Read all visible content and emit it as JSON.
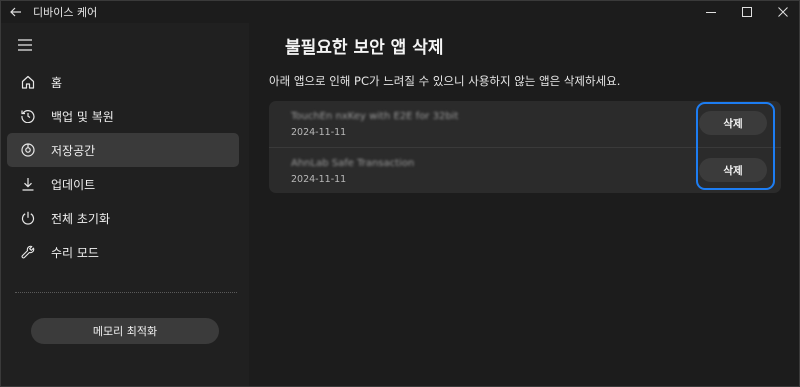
{
  "window": {
    "title": "디바이스 케어",
    "icons": {
      "back": "back-arrow-icon",
      "minimize": "minimize-icon",
      "maximize": "maximize-icon",
      "close": "close-icon"
    }
  },
  "sidebar": {
    "menu_icon": "hamburger-menu-icon",
    "items": [
      {
        "label": "홈",
        "icon": "home-icon",
        "active": false
      },
      {
        "label": "백업 및 복원",
        "icon": "backup-restore-icon",
        "active": false
      },
      {
        "label": "저장공간",
        "icon": "storage-icon",
        "active": true
      },
      {
        "label": "업데이트",
        "icon": "update-download-icon",
        "active": false
      },
      {
        "label": "전체 초기화",
        "icon": "reset-icon",
        "active": false
      },
      {
        "label": "수리 모드",
        "icon": "wrench-icon",
        "active": false
      }
    ],
    "memory_button": "메모리 최적화"
  },
  "main": {
    "title": "불필요한 보안 앱 삭제",
    "description": "아래 앱으로 인해 PC가 느려질 수 있으니 사용하지 않는 앱은 삭제하세요.",
    "apps": [
      {
        "name": "TouchEn nxKey with E2E for 32bit",
        "date": "2024-11-11",
        "delete_label": "삭제"
      },
      {
        "name": "AhnLab Safe Transaction",
        "date": "2024-11-11",
        "delete_label": "삭제"
      }
    ]
  },
  "colors": {
    "background": "#1c1c1c",
    "sidebar": "#202020",
    "card": "#2b2b2b",
    "button": "#3b3b3b",
    "highlight": "#1d7df2"
  }
}
